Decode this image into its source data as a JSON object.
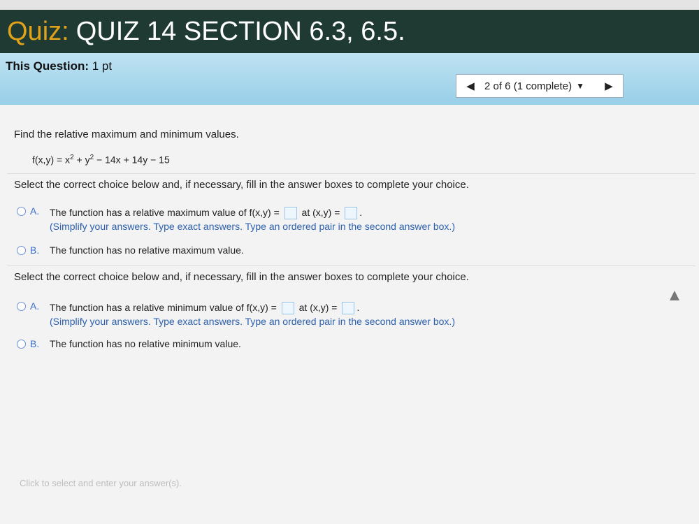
{
  "title": {
    "prefix": "Quiz:",
    "name": "QUIZ 14 SECTION 6.3, 6.5."
  },
  "question_info": {
    "label": "This Question:",
    "points": "1 pt"
  },
  "nav": {
    "prev_icon": "◀",
    "counter": "2 of 6 (1 complete)",
    "dropdown_icon": "▼",
    "next_icon": "▶"
  },
  "problem": {
    "prompt": "Find the relative maximum and minimum values.",
    "function": {
      "lhs": "f(x,y) = x",
      "exp1": "2",
      "mid": " + y",
      "exp2": "2",
      "rest": " − 14x + 14y − 15"
    }
  },
  "part1": {
    "instruction": "Select the correct choice below and, if necessary, fill in the answer boxes to complete your choice.",
    "choice_a": {
      "letter": "A.",
      "text_before": "The function has a relative maximum value of f(x,y) =",
      "text_middle": "at (x,y) =",
      "text_after": ".",
      "hint": "(Simplify your answers. Type exact answers. Type an ordered pair in the second answer box.)"
    },
    "choice_b": {
      "letter": "B.",
      "text": "The function has no relative maximum value."
    }
  },
  "part2": {
    "instruction": "Select the correct choice below and, if necessary, fill in the answer boxes to complete your choice.",
    "choice_a": {
      "letter": "A.",
      "text_before": "The function has a relative minimum value of f(x,y) =",
      "text_middle": "at (x,y) =",
      "text_after": ".",
      "hint": "(Simplify your answers. Type exact answers. Type an ordered pair in the second answer box.)"
    },
    "choice_b": {
      "letter": "B.",
      "text": "The function has no relative minimum value."
    }
  },
  "footer_hint": "Click to select and enter your answer(s).",
  "colors": {
    "title_bg": "#1e3a32",
    "title_prefix": "#e0a11b",
    "info_bar": "#98cfe8",
    "accent": "#3a6fd0"
  }
}
